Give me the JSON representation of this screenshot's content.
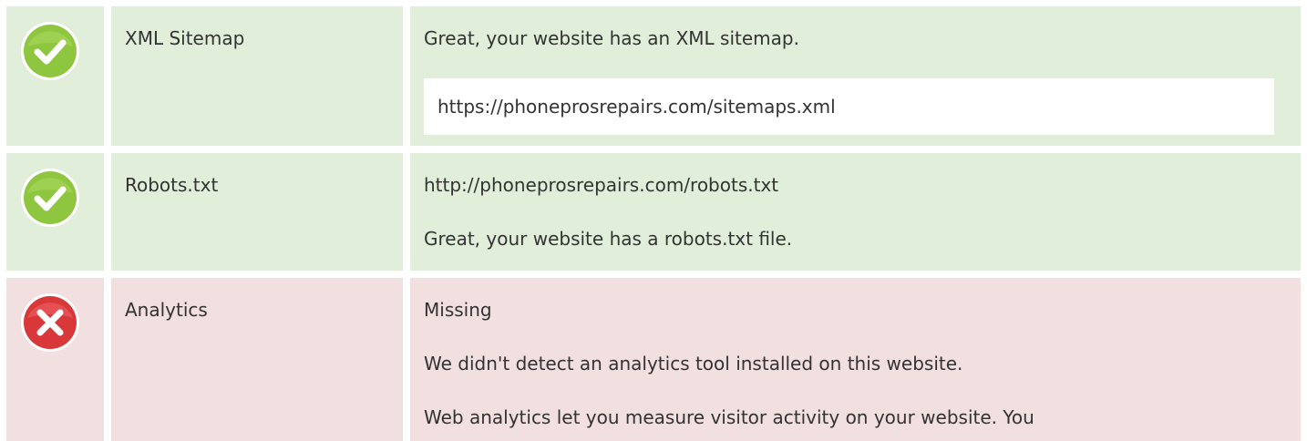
{
  "rows": [
    {
      "status": "pass",
      "status_icon": "check-circle-icon",
      "label": "XML Sitemap",
      "message": "Great, your website has an XML sitemap.",
      "url": "https://phoneprosrepairs.com/sitemaps.xml"
    },
    {
      "status": "pass",
      "status_icon": "check-circle-icon",
      "label": "Robots.txt",
      "url": "http://phoneprosrepairs.com/robots.txt",
      "message": "Great, your website has a robots.txt file."
    },
    {
      "status": "fail",
      "status_icon": "cross-circle-icon",
      "label": "Analytics",
      "result": "Missing",
      "message": "We didn't detect an analytics tool installed on this website.",
      "description": "Web analytics let you measure visitor activity on your website. You"
    }
  ],
  "colors": {
    "pass_background": "#e1efda",
    "fail_background": "#f2dfdf",
    "pass_icon": "#8fc640",
    "fail_icon": "#d9383b"
  }
}
